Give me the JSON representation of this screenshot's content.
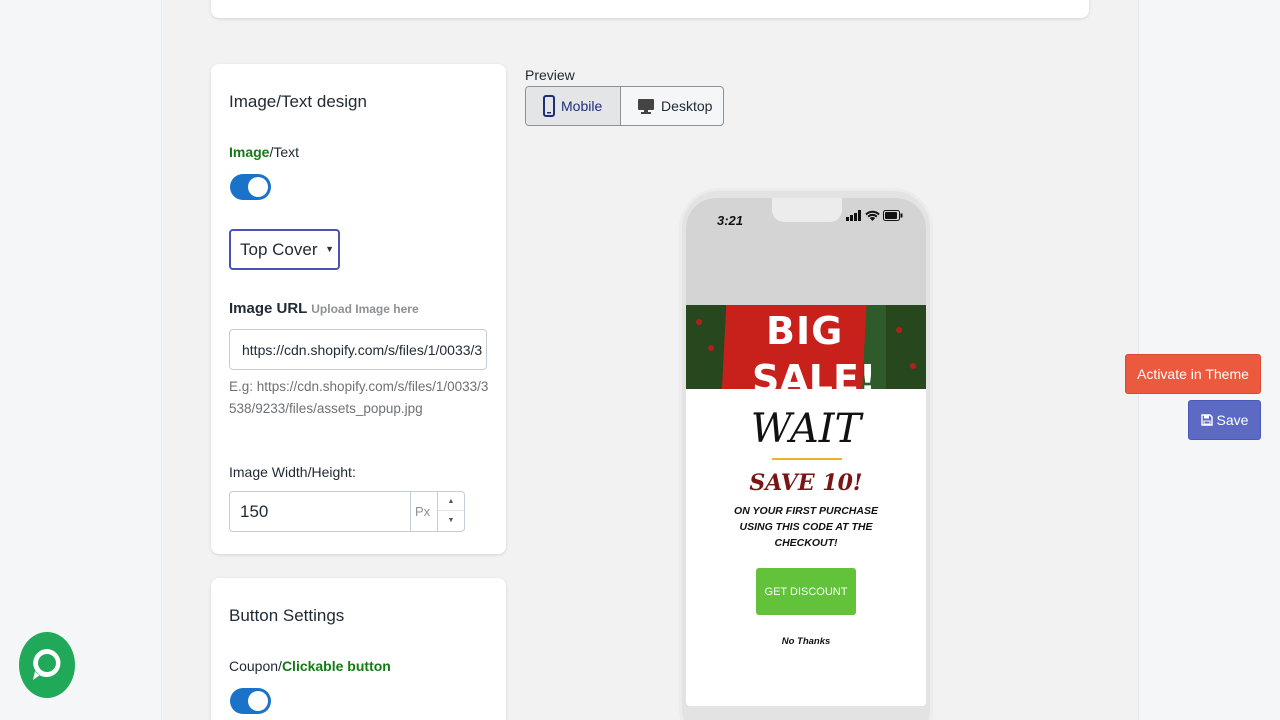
{
  "design_card": {
    "title": "Image/Text design",
    "toggle_highlight": "Image",
    "toggle_rest": "/Text",
    "toggle_on": true,
    "layout_select": "Top Cover",
    "image_url_label": "Image URL",
    "image_url_hint": "Upload Image here",
    "image_url_value": "https://cdn.shopify.com/s/files/1/0033/3",
    "example_text": "E.g: https://cdn.shopify.com/s/files/1/0033/3538/9233/files/assets_popup.jpg",
    "size_label": "Image Width/Height:",
    "size_value": "150",
    "size_unit": "Px"
  },
  "button_card": {
    "title": "Button Settings",
    "toggle_rest": "Coupon/",
    "toggle_highlight": "Clickable button",
    "toggle_on": true
  },
  "preview": {
    "label": "Preview",
    "mobile_label": "Mobile",
    "desktop_label": "Desktop",
    "selected": "Mobile"
  },
  "phone": {
    "time": "3:21",
    "banner_big": "BIG",
    "banner_sale": "SALE!",
    "heading": "WAIT",
    "offer": "SAVE 10!",
    "subtext": "ON YOUR FIRST PURCHASE USING THIS CODE AT THE CHECKOUT!",
    "cta": "GET DISCOUNT",
    "dismiss": "No Thanks"
  },
  "actions": {
    "activate_label": "Activate in Theme",
    "save_label": "Save"
  },
  "colors": {
    "toggle": "#1a73c8",
    "highlight_green": "#137a14",
    "activate": "#eb5a3f",
    "save": "#5c6ac4",
    "cta": "#62c33b",
    "chat": "#21a95a"
  },
  "icons": [
    "mobile-icon",
    "desktop-icon",
    "save-icon",
    "chat-icon",
    "signal-icon",
    "wifi-icon",
    "battery-icon"
  ]
}
